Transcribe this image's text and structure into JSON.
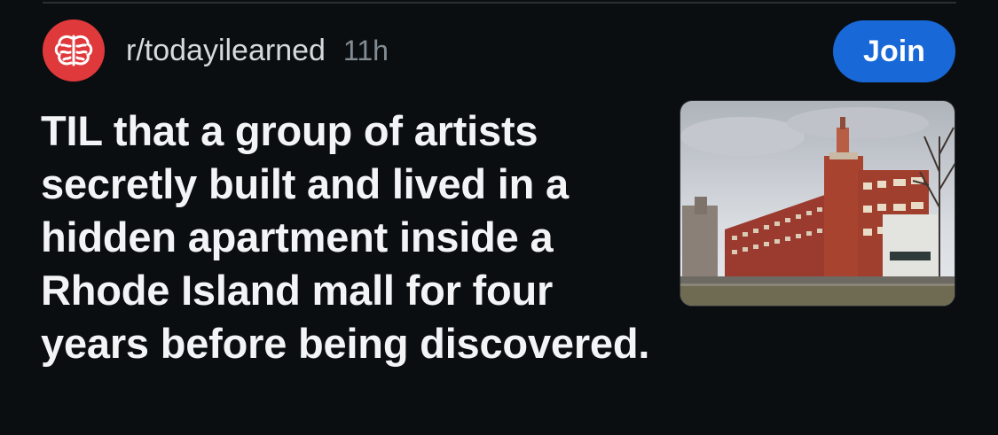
{
  "post": {
    "subreddit": "r/todayilearned",
    "age": "11h",
    "join_label": "Join",
    "title": "TIL that a group of artists secretly built and lived in a hidden apartment inside a Rhode Island mall for four years before being discovered.",
    "avatar_icon": "brain-icon",
    "thumbnail": "mall-building-photo"
  },
  "colors": {
    "background": "#0b0e11",
    "avatar": "#e0393c",
    "join_button": "#1868d8",
    "title_text": "#f2f4f5",
    "meta_text": "#828c93"
  }
}
